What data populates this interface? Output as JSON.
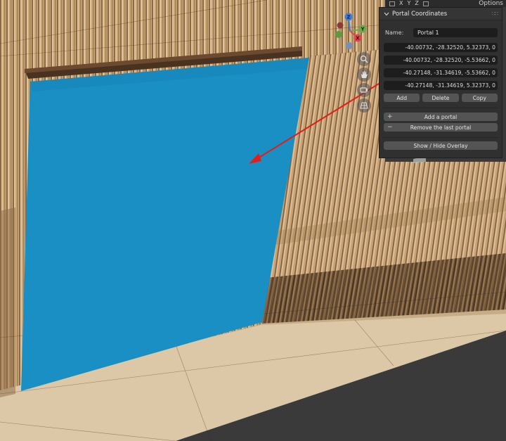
{
  "header": {
    "options_label": "Options",
    "items": [
      "X",
      "Y",
      "Z"
    ]
  },
  "gizmo": {
    "z_label": "Z",
    "y_label": "Y",
    "x_label": "X",
    "colors": {
      "x": "#e0464e",
      "y": "#6ea84a",
      "z": "#3f7ddb"
    }
  },
  "panel": {
    "title": "Portal Coordinates",
    "name_label": "Name:",
    "name_value": "Portal 1",
    "coords": [
      "-40.00732, -28.32520,  5.32373, 0",
      "-40.00732, -28.32520, -5.53662, 0",
      "-40.27148, -31.34619, -5.53662, 0",
      "-40.27148, -31.34619,  5.32373, 0"
    ],
    "add_label": "Add",
    "delete_label": "Delete",
    "copy_label": "Copy",
    "add_portal_label": "Add a portal",
    "remove_portal_label": "Remove the last portal",
    "overlay_label": "Show / Hide Overlay"
  },
  "colors": {
    "portal": "#1a8fc4",
    "arrow": "#e31c1c",
    "panel_bg": "#303030"
  }
}
